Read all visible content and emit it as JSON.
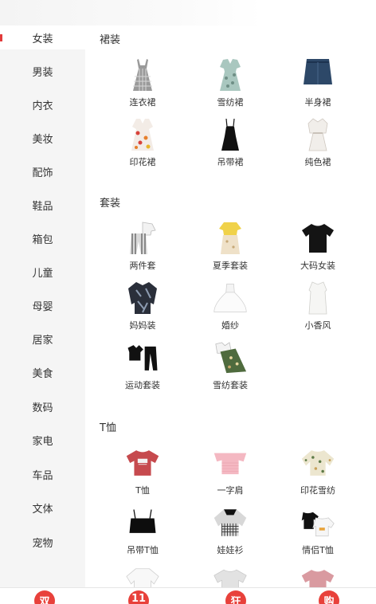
{
  "sidebar": {
    "items": [
      {
        "label": "女装",
        "active": true
      },
      {
        "label": "男装"
      },
      {
        "label": "内衣"
      },
      {
        "label": "美妆"
      },
      {
        "label": "配饰"
      },
      {
        "label": "鞋品"
      },
      {
        "label": "箱包"
      },
      {
        "label": "儿童"
      },
      {
        "label": "母婴"
      },
      {
        "label": "居家"
      },
      {
        "label": "美食"
      },
      {
        "label": "数码"
      },
      {
        "label": "家电"
      },
      {
        "label": "车品"
      },
      {
        "label": "文体"
      },
      {
        "label": "宠物"
      }
    ]
  },
  "sections": [
    {
      "title": "裙装",
      "items": [
        {
          "label": "连衣裙",
          "icon": "plaid-dress-icon"
        },
        {
          "label": "雪纺裙",
          "icon": "chiffon-dress-icon"
        },
        {
          "label": "半身裙",
          "icon": "denim-skirt-icon"
        },
        {
          "label": "印花裙",
          "icon": "print-dress-icon"
        },
        {
          "label": "吊带裙",
          "icon": "slip-dress-icon"
        },
        {
          "label": "纯色裙",
          "icon": "solid-dress-icon"
        }
      ]
    },
    {
      "title": "套装",
      "items": [
        {
          "label": "两件套",
          "icon": "two-piece-icon"
        },
        {
          "label": "夏季套装",
          "icon": "summer-set-icon"
        },
        {
          "label": "大码女装",
          "icon": "plus-size-icon"
        },
        {
          "label": "妈妈装",
          "icon": "mom-wear-icon"
        },
        {
          "label": "婚纱",
          "icon": "wedding-dress-icon"
        },
        {
          "label": "小香风",
          "icon": "tweed-dress-icon"
        },
        {
          "label": "运动套装",
          "icon": "sports-set-icon"
        },
        {
          "label": "雪纺套装",
          "icon": "chiffon-set-icon"
        }
      ]
    },
    {
      "title": "T恤",
      "items": [
        {
          "label": "T恤",
          "icon": "tshirt-icon"
        },
        {
          "label": "一字肩",
          "icon": "off-shoulder-icon"
        },
        {
          "label": "印花雪纺",
          "icon": "floral-chiffon-icon"
        },
        {
          "label": "吊带T恤",
          "icon": "camisole-icon"
        },
        {
          "label": "娃娃衫",
          "icon": "doll-shirt-icon"
        },
        {
          "label": "情侣T恤",
          "icon": "couple-tshirt-icon"
        },
        {
          "label": "",
          "icon": "white-blouse-icon"
        },
        {
          "label": "",
          "icon": "grey-tshirt-icon"
        },
        {
          "label": "",
          "icon": "pink-tshirt-icon"
        }
      ]
    }
  ],
  "bottom_nav": {
    "tabs": [
      {
        "label": "双"
      },
      {
        "label": "11"
      },
      {
        "label": "狂"
      },
      {
        "label": "购"
      }
    ]
  },
  "colors": {
    "accent": "#e8413b",
    "sidebar_bg": "#f5f5f5"
  }
}
